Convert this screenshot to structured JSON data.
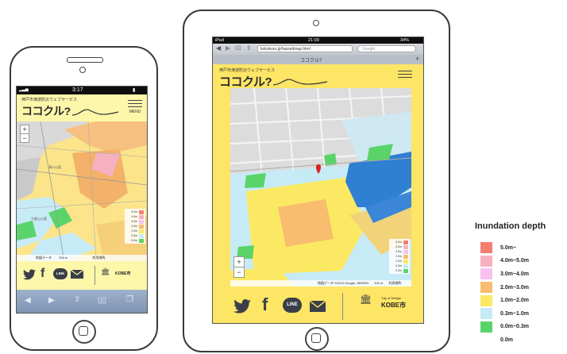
{
  "phone": {
    "status": {
      "time": "3:17"
    },
    "header": {
      "subtitle": "神戸市津波防災ウェブサービス",
      "title": "ココクル?",
      "menu_label": "MENU"
    },
    "map": {
      "zoom_in": "+",
      "zoom_out": "−",
      "labels": [
        "湊川公園",
        "大倉山公園"
      ],
      "attribution": "地図データ",
      "scale": "200 m",
      "terms": "利用規約",
      "legend": [
        "5.0m",
        "4.0m",
        "3.0m",
        "2.0m",
        "1.0m",
        "0.3m",
        "0.0m"
      ]
    },
    "social": {
      "line": "LINE",
      "kobe": "KOBE市"
    }
  },
  "tablet": {
    "status": {
      "left": "iPad",
      "time": "21:09",
      "battery": "34% "
    },
    "browser": {
      "url": "kokokuru.jp/hazardmap.html",
      "search_placeholder": "Google",
      "tab_title": "ココクル?"
    },
    "header": {
      "subtitle": "神戸市津波防災ウェブサービス",
      "title": "ココクル?"
    },
    "map": {
      "zoom_in": "+",
      "zoom_out": "−",
      "attribution": "地図データ ©2014 Google, ZENRIN",
      "scale": "100 m",
      "terms": "利用規約",
      "legend": [
        "5.0m",
        "4.0m",
        "3.0m",
        "2.0m",
        "1.0m",
        "0.3m",
        "0.0m"
      ]
    },
    "social": {
      "line": "LINE",
      "city_of_design": "City of Design",
      "kobe": "KOBE市"
    }
  },
  "legend": {
    "title": "Inundation depth",
    "items": [
      {
        "label": "5.0m~",
        "color": "#f47f6e"
      },
      {
        "label": "4.0m~5.0m",
        "color": "#f7b0c0"
      },
      {
        "label": "3.0m~4.0m",
        "color": "#f6c1ee"
      },
      {
        "label": "2.0m~3.0m",
        "color": "#f8bd6e"
      },
      {
        "label": "1.0m~2.0m",
        "color": "#fbe964"
      },
      {
        "label": "0.3m~1.0m",
        "color": "#c7ebf6"
      },
      {
        "label": "0.0m~0.3m",
        "color": "#5ad46a"
      },
      {
        "label": "0.0m",
        "color": "#ffffff"
      }
    ]
  }
}
